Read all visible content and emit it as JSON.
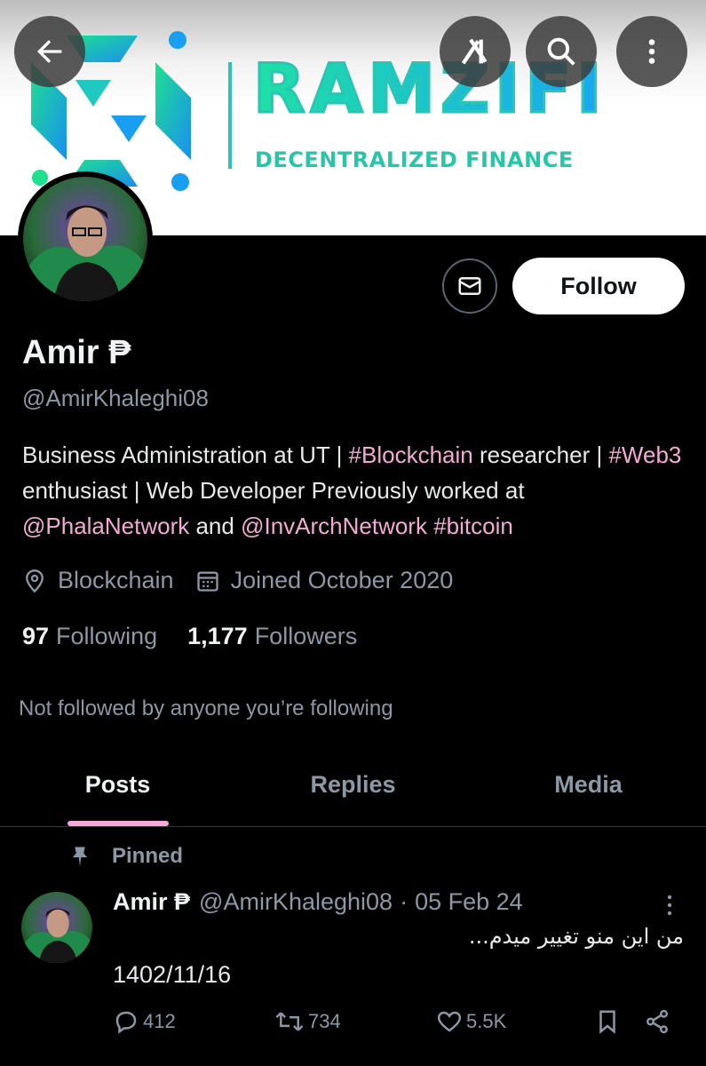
{
  "banner": {
    "brand": "RAMZIFI",
    "tagline": "DECENTRALIZED FINANCE"
  },
  "header": {
    "back_icon": "arrow-left-icon",
    "grok_icon": "grok-icon",
    "search_icon": "search-icon",
    "more_icon": "more-vertical-icon"
  },
  "profile": {
    "follow_label": "Follow",
    "name": "Amir ₱",
    "handle": "@AmirKhaleghi08",
    "bio": {
      "p1": "Business Administration at UT | ",
      "tag1": "#Blockchain",
      "p2": " researcher | ",
      "tag2": "#Web3",
      "p3": " enthusiast | Web Developer Previously worked at ",
      "mention1": "@PhalaNetwork",
      "p4": " and ",
      "mention2": "@InvArchNetwork",
      "p5": " ",
      "tag3": "#bitcoin"
    },
    "location": "Blockchain",
    "joined": "Joined October 2020",
    "following_count": "97",
    "following_label": "Following",
    "followers_count": "1,177",
    "followers_label": "Followers",
    "not_followed": "Not followed by anyone you’re following"
  },
  "tabs": [
    {
      "label": "Posts"
    },
    {
      "label": "Replies"
    },
    {
      "label": "Media"
    }
  ],
  "post": {
    "pinned_label": "Pinned",
    "name": "Amir ₱",
    "handle": "@AmirKhaleghi08",
    "separator": "·",
    "date": "05 Feb 24",
    "text_line1": "من این منو تغییر میدم...",
    "text_line2": "1402/11/16",
    "replies": "412",
    "reposts": "734",
    "likes": "5.5K"
  },
  "colors": {
    "accent": "#f5a9d6",
    "muted": "#8b98a5",
    "background": "#000000"
  }
}
